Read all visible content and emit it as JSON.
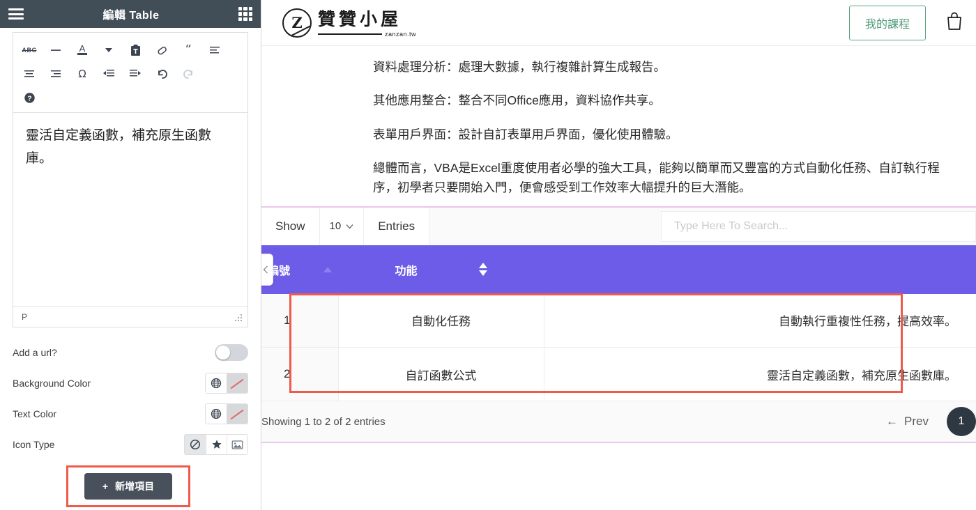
{
  "editor": {
    "title": "編輯 Table",
    "menu_icon": "hamburger-icon",
    "apps_icon": "grid-icon",
    "toolbar": {
      "row1": [
        {
          "name": "strikethrough-button",
          "label": "ABC"
        },
        {
          "name": "horizontal-rule-button",
          "label": "—"
        },
        {
          "name": "text-color-button",
          "label": "A"
        },
        {
          "name": "text-color-dropdown",
          "label": "▾"
        },
        {
          "name": "paste-button",
          "label": "clipboard"
        },
        {
          "name": "clear-format-button",
          "label": "eraser"
        },
        {
          "name": "blockquote-button",
          "label": "“"
        },
        {
          "name": "align-left-button",
          "label": "align-left"
        }
      ],
      "row2": [
        {
          "name": "align-center-button",
          "label": "align-center"
        },
        {
          "name": "align-right-button",
          "label": "align-right"
        },
        {
          "name": "special-char-button",
          "label": "Ω"
        },
        {
          "name": "outdent-button",
          "label": "outdent"
        },
        {
          "name": "indent-button",
          "label": "indent"
        },
        {
          "name": "undo-button",
          "label": "undo"
        },
        {
          "name": "redo-button",
          "label": "redo"
        }
      ],
      "row3": [
        {
          "name": "help-button",
          "label": "?"
        }
      ]
    },
    "content": "靈活自定義函數，補充原生函數庫。",
    "status_path": "P",
    "options": [
      {
        "label": "Add a url?",
        "type": "toggle",
        "value": "off"
      },
      {
        "label": "Background Color",
        "type": "color",
        "value": "none"
      },
      {
        "label": "Text Color",
        "type": "color",
        "value": "none"
      },
      {
        "label": "Icon Type",
        "type": "segmented",
        "value": "none"
      }
    ],
    "add_item_button": "新增項目",
    "add_item_plus": "+"
  },
  "site": {
    "logo": {
      "mark": "Z",
      "name": "贊贊小屋",
      "domain": "zanzan.tw"
    },
    "my_course_button": "我的課程",
    "cart_icon": "shopping-bag-icon",
    "article": [
      "資料處理分析：處理大數據，執行複雜計算生成報告。",
      "其他應用整合：整合不同Office應用，資料協作共享。",
      "表單用戶界面：設計自訂表單用戶界面，優化使用體驗。",
      "總體而言，VBA是Excel重度使用者必學的強大工具，能夠以簡單而又豐富的方式自動化任務、自訂執行程序，初學者只要開始入門，便會感受到工作效率大幅提升的巨大潛能。"
    ],
    "datatable": {
      "show_label": "Show",
      "page_length": "10",
      "entries_label": "Entries",
      "search_placeholder": "Type Here To Search...",
      "search_value": "",
      "collapse_icon": "chevron-left-icon",
      "columns": [
        {
          "label": "編號",
          "sort": "asc"
        },
        {
          "label": "功能",
          "sort": "none"
        },
        {
          "label": "",
          "sort": "none"
        }
      ],
      "rows": [
        {
          "id": "1",
          "feature": "自動化任務",
          "desc": "自動執行重複性任務，提高效率。"
        },
        {
          "id": "2",
          "feature": "自訂函數公式",
          "desc": "靈活自定義函數，補充原生函數庫。"
        }
      ],
      "showing_text": "Showing 1 to 2 of 2 entries",
      "prev_label": "Prev",
      "prev_arrow": "←",
      "current_page": "1"
    }
  },
  "colors": {
    "editor_header": "#414d57",
    "table_header": "#6c5ce7",
    "highlight": "#f05a4b",
    "accent_green": "#4e9b78",
    "rule_pink": "#e8c8ec",
    "pager_dark": "#2d3842"
  }
}
